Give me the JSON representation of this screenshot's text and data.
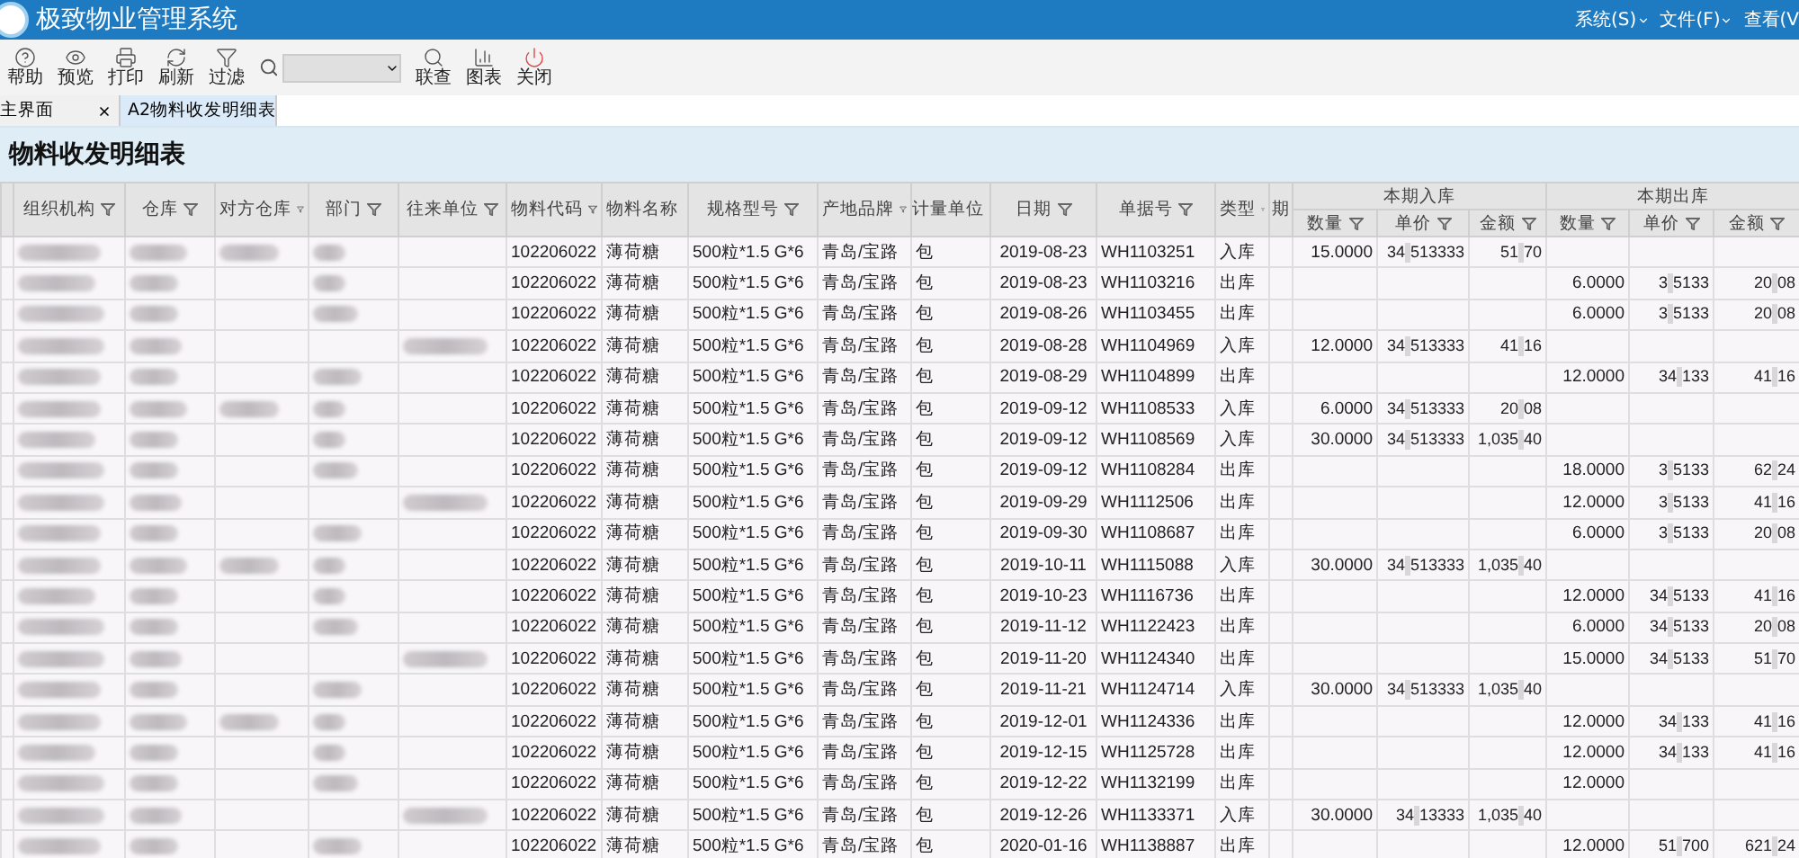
{
  "app": {
    "title": "极致物业管理系统",
    "menus": [
      "系统(S)",
      "文件(F)",
      "查看(V"
    ]
  },
  "toolbar": {
    "buttons": [
      "帮助",
      "预览",
      "打印",
      "刷新",
      "过滤"
    ],
    "after_search": [
      "联查",
      "图表",
      "关闭"
    ]
  },
  "tabs": [
    {
      "label": "主界面",
      "selected": false
    },
    {
      "label": "A2物料收发明细表",
      "selected": true
    }
  ],
  "report_title": "物料收发明细表",
  "columns": [
    "组织机构",
    "仓库",
    "对方仓库",
    "部门",
    "往来单位",
    "物料代码",
    "物料名称",
    "规格型号",
    "产地品牌",
    "计量单位",
    "日期",
    "单据号",
    "类型",
    "期"
  ],
  "groups": [
    {
      "label": "本期入库",
      "columns": [
        "数量",
        "单价",
        "金额"
      ]
    },
    {
      "label": "本期出库",
      "columns": [
        "数量",
        "单价",
        "金额"
      ]
    }
  ],
  "rows": [
    {
      "code": "102206022",
      "name": "薄荷糖",
      "spec": "500粒*1.5 G*6",
      "origin": "青岛/宝路",
      "unit": "包",
      "date": "2019-08-23",
      "doc": "WH1103251",
      "type": "入库",
      "kind": "in",
      "qty": "15.0000",
      "price": [
        "34",
        "513333"
      ],
      "amount": [
        "51",
        "70"
      ]
    },
    {
      "code": "102206022",
      "name": "薄荷糖",
      "spec": "500粒*1.5 G*6",
      "origin": "青岛/宝路",
      "unit": "包",
      "date": "2019-08-23",
      "doc": "WH1103216",
      "type": "出库",
      "kind": "out",
      "qty": "6.0000",
      "price": [
        "3",
        "5133"
      ],
      "amount": [
        "20",
        "08"
      ]
    },
    {
      "code": "102206022",
      "name": "薄荷糖",
      "spec": "500粒*1.5 G*6",
      "origin": "青岛/宝路",
      "unit": "包",
      "date": "2019-08-26",
      "doc": "WH1103455",
      "type": "出库",
      "kind": "out",
      "qty": "6.0000",
      "price": [
        "3",
        "5133"
      ],
      "amount": [
        "20",
        "08"
      ]
    },
    {
      "code": "102206022",
      "name": "薄荷糖",
      "spec": "500粒*1.5 G*6",
      "origin": "青岛/宝路",
      "unit": "包",
      "date": "2019-08-28",
      "doc": "WH1104969",
      "type": "入库",
      "kind": "in",
      "qty": "12.0000",
      "price": [
        "34",
        "513333"
      ],
      "amount": [
        "41",
        "16"
      ]
    },
    {
      "code": "102206022",
      "name": "薄荷糖",
      "spec": "500粒*1.5 G*6",
      "origin": "青岛/宝路",
      "unit": "包",
      "date": "2019-08-29",
      "doc": "WH1104899",
      "type": "出库",
      "kind": "out",
      "qty": "12.0000",
      "price": [
        "34",
        "133"
      ],
      "amount": [
        "41",
        "16"
      ]
    },
    {
      "code": "102206022",
      "name": "薄荷糖",
      "spec": "500粒*1.5 G*6",
      "origin": "青岛/宝路",
      "unit": "包",
      "date": "2019-09-12",
      "doc": "WH1108533",
      "type": "入库",
      "kind": "in",
      "qty": "6.0000",
      "price": [
        "34",
        "513333"
      ],
      "amount": [
        "20",
        "08"
      ]
    },
    {
      "code": "102206022",
      "name": "薄荷糖",
      "spec": "500粒*1.5 G*6",
      "origin": "青岛/宝路",
      "unit": "包",
      "date": "2019-09-12",
      "doc": "WH1108569",
      "type": "入库",
      "kind": "in",
      "qty": "30.0000",
      "price": [
        "34",
        "513333"
      ],
      "amount": [
        "1,035",
        "40"
      ]
    },
    {
      "code": "102206022",
      "name": "薄荷糖",
      "spec": "500粒*1.5 G*6",
      "origin": "青岛/宝路",
      "unit": "包",
      "date": "2019-09-12",
      "doc": "WH1108284",
      "type": "出库",
      "kind": "out",
      "qty": "18.0000",
      "price": [
        "3",
        "5133"
      ],
      "amount": [
        "62",
        "24"
      ]
    },
    {
      "code": "102206022",
      "name": "薄荷糖",
      "spec": "500粒*1.5 G*6",
      "origin": "青岛/宝路",
      "unit": "包",
      "date": "2019-09-29",
      "doc": "WH1112506",
      "type": "出库",
      "kind": "out",
      "qty": "12.0000",
      "price": [
        "3",
        "5133"
      ],
      "amount": [
        "41",
        "16"
      ]
    },
    {
      "code": "102206022",
      "name": "薄荷糖",
      "spec": "500粒*1.5 G*6",
      "origin": "青岛/宝路",
      "unit": "包",
      "date": "2019-09-30",
      "doc": "WH1108687",
      "type": "出库",
      "kind": "out",
      "qty": "6.0000",
      "price": [
        "3",
        "5133"
      ],
      "amount": [
        "20",
        "08"
      ]
    },
    {
      "code": "102206022",
      "name": "薄荷糖",
      "spec": "500粒*1.5 G*6",
      "origin": "青岛/宝路",
      "unit": "包",
      "date": "2019-10-11",
      "doc": "WH1115088",
      "type": "入库",
      "kind": "in",
      "qty": "30.0000",
      "price": [
        "34",
        "513333"
      ],
      "amount": [
        "1,035",
        "40"
      ]
    },
    {
      "code": "102206022",
      "name": "薄荷糖",
      "spec": "500粒*1.5 G*6",
      "origin": "青岛/宝路",
      "unit": "包",
      "date": "2019-10-23",
      "doc": "WH1116736",
      "type": "出库",
      "kind": "out",
      "qty": "12.0000",
      "price": [
        "34",
        "5133"
      ],
      "amount": [
        "41",
        "16"
      ]
    },
    {
      "code": "102206022",
      "name": "薄荷糖",
      "spec": "500粒*1.5 G*6",
      "origin": "青岛/宝路",
      "unit": "包",
      "date": "2019-11-12",
      "doc": "WH1122423",
      "type": "出库",
      "kind": "out",
      "qty": "6.0000",
      "price": [
        "34",
        "5133"
      ],
      "amount": [
        "20",
        "08"
      ]
    },
    {
      "code": "102206022",
      "name": "薄荷糖",
      "spec": "500粒*1.5 G*6",
      "origin": "青岛/宝路",
      "unit": "包",
      "date": "2019-11-20",
      "doc": "WH1124340",
      "type": "出库",
      "kind": "out",
      "qty": "15.0000",
      "price": [
        "34",
        "5133"
      ],
      "amount": [
        "51",
        "70"
      ]
    },
    {
      "code": "102206022",
      "name": "薄荷糖",
      "spec": "500粒*1.5 G*6",
      "origin": "青岛/宝路",
      "unit": "包",
      "date": "2019-11-21",
      "doc": "WH1124714",
      "type": "入库",
      "kind": "in",
      "qty": "30.0000",
      "price": [
        "34",
        "513333"
      ],
      "amount": [
        "1,035",
        "40"
      ]
    },
    {
      "code": "102206022",
      "name": "薄荷糖",
      "spec": "500粒*1.5 G*6",
      "origin": "青岛/宝路",
      "unit": "包",
      "date": "2019-12-01",
      "doc": "WH1124336",
      "type": "出库",
      "kind": "out",
      "qty": "12.0000",
      "price": [
        "34",
        "133"
      ],
      "amount": [
        "41",
        "16"
      ]
    },
    {
      "code": "102206022",
      "name": "薄荷糖",
      "spec": "500粒*1.5 G*6",
      "origin": "青岛/宝路",
      "unit": "包",
      "date": "2019-12-15",
      "doc": "WH1125728",
      "type": "出库",
      "kind": "out",
      "qty": "12.0000",
      "price": [
        "34",
        "133"
      ],
      "amount": [
        "41",
        "16"
      ]
    },
    {
      "code": "102206022",
      "name": "薄荷糖",
      "spec": "500粒*1.5 G*6",
      "origin": "青岛/宝路",
      "unit": "包",
      "date": "2019-12-22",
      "doc": "WH1132199",
      "type": "出库",
      "kind": "out",
      "qty": "12.0000"
    },
    {
      "code": "102206022",
      "name": "薄荷糖",
      "spec": "500粒*1.5 G*6",
      "origin": "青岛/宝路",
      "unit": "包",
      "date": "2019-12-26",
      "doc": "WH1133371",
      "type": "入库",
      "kind": "in",
      "qty": "30.0000",
      "price": [
        "34",
        "13333"
      ],
      "amount": [
        "1,035",
        "40"
      ]
    },
    {
      "code": "102206022",
      "name": "薄荷糖",
      "spec": "500粒*1.5 G*6",
      "origin": "青岛/宝路",
      "unit": "包",
      "date": "2020-01-16",
      "doc": "WH1138887",
      "type": "出库",
      "kind": "out",
      "qty": "12.0000",
      "price": [
        "51",
        "700"
      ],
      "amount": [
        "621",
        "24"
      ]
    }
  ]
}
